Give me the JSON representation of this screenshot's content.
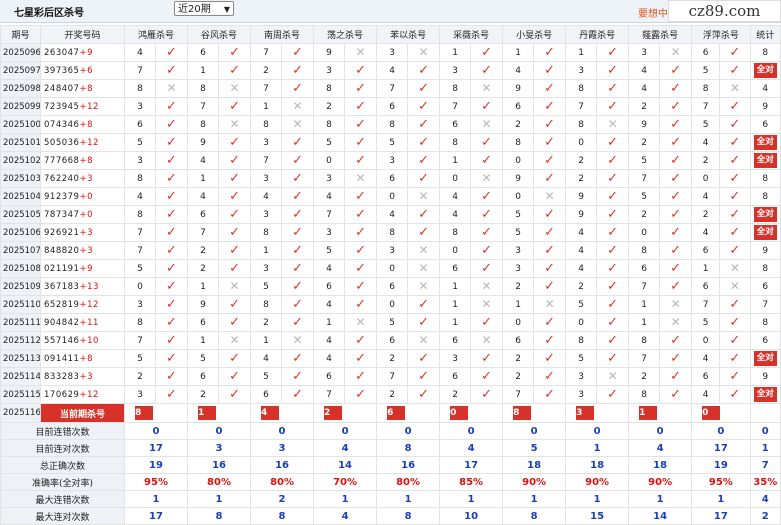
{
  "header": {
    "title": "七星彩后区杀号",
    "select_value": "近20期",
    "promo": "要想中大",
    "logo": "cz89.com"
  },
  "columns": {
    "period": "期号",
    "draw": "开奖号码",
    "experts": [
      "鸿雁杀号",
      "谷风杀号",
      "南周杀号",
      "荡之杀号",
      "苯以杀号",
      "采薇杀号",
      "小旻杀号",
      "丹霞杀号",
      "薤露杀号",
      "浮萍杀号"
    ],
    "total": "统计"
  },
  "rows": [
    {
      "period": "2025096",
      "draw": "263047",
      "sum": "+9",
      "picks": [
        [
          4,
          1
        ],
        [
          6,
          1
        ],
        [
          7,
          1
        ],
        [
          9,
          0
        ],
        [
          3,
          0
        ],
        [
          1,
          1
        ],
        [
          1,
          1
        ],
        [
          1,
          1
        ],
        [
          3,
          0
        ],
        [
          6,
          1
        ]
      ],
      "total": "8"
    },
    {
      "period": "2025097",
      "draw": "397365",
      "sum": "+6",
      "picks": [
        [
          7,
          1
        ],
        [
          1,
          1
        ],
        [
          2,
          1
        ],
        [
          3,
          1
        ],
        [
          4,
          1
        ],
        [
          3,
          1
        ],
        [
          4,
          1
        ],
        [
          3,
          1
        ],
        [
          4,
          1
        ],
        [
          5,
          1
        ]
      ],
      "total": "全对"
    },
    {
      "period": "2025098",
      "draw": "248407",
      "sum": "+8",
      "picks": [
        [
          8,
          0
        ],
        [
          8,
          0
        ],
        [
          7,
          1
        ],
        [
          8,
          1
        ],
        [
          7,
          1
        ],
        [
          8,
          0
        ],
        [
          9,
          1
        ],
        [
          8,
          1
        ],
        [
          4,
          1
        ],
        [
          8,
          0
        ]
      ],
      "total": "4"
    },
    {
      "period": "2025099",
      "draw": "723945",
      "sum": "+12",
      "picks": [
        [
          3,
          1
        ],
        [
          7,
          1
        ],
        [
          1,
          0
        ],
        [
          2,
          1
        ],
        [
          6,
          1
        ],
        [
          7,
          1
        ],
        [
          6,
          1
        ],
        [
          7,
          1
        ],
        [
          2,
          1
        ],
        [
          7,
          1
        ]
      ],
      "total": "9"
    },
    {
      "period": "2025100",
      "draw": "074346",
      "sum": "+8",
      "picks": [
        [
          6,
          1
        ],
        [
          8,
          0
        ],
        [
          8,
          0
        ],
        [
          8,
          1
        ],
        [
          8,
          1
        ],
        [
          6,
          0
        ],
        [
          2,
          1
        ],
        [
          8,
          0
        ],
        [
          9,
          1
        ],
        [
          5,
          1
        ]
      ],
      "total": "6"
    },
    {
      "period": "2025101",
      "draw": "505036",
      "sum": "+12",
      "picks": [
        [
          5,
          1
        ],
        [
          9,
          1
        ],
        [
          3,
          1
        ],
        [
          5,
          1
        ],
        [
          5,
          1
        ],
        [
          8,
          1
        ],
        [
          8,
          1
        ],
        [
          0,
          1
        ],
        [
          2,
          1
        ],
        [
          4,
          1
        ]
      ],
      "total": "全对"
    },
    {
      "period": "2025102",
      "draw": "777668",
      "sum": "+8",
      "picks": [
        [
          3,
          1
        ],
        [
          4,
          1
        ],
        [
          7,
          1
        ],
        [
          0,
          1
        ],
        [
          3,
          1
        ],
        [
          1,
          1
        ],
        [
          0,
          1
        ],
        [
          2,
          1
        ],
        [
          5,
          1
        ],
        [
          2,
          1
        ]
      ],
      "total": "全对"
    },
    {
      "period": "2025103",
      "draw": "762240",
      "sum": "+3",
      "picks": [
        [
          8,
          1
        ],
        [
          1,
          1
        ],
        [
          3,
          1
        ],
        [
          3,
          0
        ],
        [
          6,
          1
        ],
        [
          0,
          0
        ],
        [
          9,
          1
        ],
        [
          2,
          1
        ],
        [
          7,
          1
        ],
        [
          0,
          1
        ]
      ],
      "total": "8"
    },
    {
      "period": "2025104",
      "draw": "912379",
      "sum": "+0",
      "picks": [
        [
          4,
          1
        ],
        [
          4,
          1
        ],
        [
          4,
          1
        ],
        [
          4,
          1
        ],
        [
          0,
          0
        ],
        [
          4,
          1
        ],
        [
          0,
          0
        ],
        [
          9,
          1
        ],
        [
          5,
          1
        ],
        [
          4,
          1
        ]
      ],
      "total": "8"
    },
    {
      "period": "2025105",
      "draw": "787347",
      "sum": "+0",
      "picks": [
        [
          8,
          1
        ],
        [
          6,
          1
        ],
        [
          3,
          1
        ],
        [
          7,
          1
        ],
        [
          4,
          1
        ],
        [
          4,
          1
        ],
        [
          5,
          1
        ],
        [
          9,
          1
        ],
        [
          2,
          1
        ],
        [
          2,
          1
        ]
      ],
      "total": "全对"
    },
    {
      "period": "2025106",
      "draw": "926921",
      "sum": "+3",
      "picks": [
        [
          7,
          1
        ],
        [
          7,
          1
        ],
        [
          8,
          1
        ],
        [
          3,
          1
        ],
        [
          8,
          1
        ],
        [
          8,
          1
        ],
        [
          5,
          1
        ],
        [
          4,
          1
        ],
        [
          0,
          1
        ],
        [
          4,
          1
        ]
      ],
      "total": "全对"
    },
    {
      "period": "2025107",
      "draw": "848820",
      "sum": "+3",
      "picks": [
        [
          7,
          1
        ],
        [
          2,
          1
        ],
        [
          1,
          1
        ],
        [
          5,
          1
        ],
        [
          3,
          0
        ],
        [
          0,
          1
        ],
        [
          3,
          1
        ],
        [
          4,
          1
        ],
        [
          8,
          1
        ],
        [
          6,
          1
        ]
      ],
      "total": "9"
    },
    {
      "period": "2025108",
      "draw": "021191",
      "sum": "+9",
      "picks": [
        [
          5,
          1
        ],
        [
          2,
          1
        ],
        [
          3,
          1
        ],
        [
          4,
          1
        ],
        [
          0,
          0
        ],
        [
          6,
          1
        ],
        [
          3,
          1
        ],
        [
          4,
          1
        ],
        [
          6,
          1
        ],
        [
          1,
          0
        ]
      ],
      "total": "8"
    },
    {
      "period": "2025109",
      "draw": "367183",
      "sum": "+13",
      "picks": [
        [
          0,
          1
        ],
        [
          1,
          0
        ],
        [
          5,
          1
        ],
        [
          6,
          1
        ],
        [
          6,
          0
        ],
        [
          1,
          0
        ],
        [
          2,
          1
        ],
        [
          2,
          1
        ],
        [
          7,
          1
        ],
        [
          6,
          0
        ]
      ],
      "total": "6"
    },
    {
      "period": "2025110",
      "draw": "652819",
      "sum": "+12",
      "picks": [
        [
          3,
          1
        ],
        [
          9,
          1
        ],
        [
          8,
          1
        ],
        [
          4,
          1
        ],
        [
          0,
          1
        ],
        [
          1,
          0
        ],
        [
          1,
          0
        ],
        [
          5,
          1
        ],
        [
          1,
          0
        ],
        [
          7,
          1
        ]
      ],
      "total": "7"
    },
    {
      "period": "2025111",
      "draw": "904842",
      "sum": "+11",
      "picks": [
        [
          8,
          1
        ],
        [
          6,
          1
        ],
        [
          2,
          1
        ],
        [
          1,
          0
        ],
        [
          5,
          1
        ],
        [
          1,
          1
        ],
        [
          0,
          1
        ],
        [
          0,
          1
        ],
        [
          1,
          0
        ],
        [
          5,
          1
        ]
      ],
      "total": "8"
    },
    {
      "period": "2025112",
      "draw": "557146",
      "sum": "+10",
      "picks": [
        [
          7,
          1
        ],
        [
          1,
          0
        ],
        [
          1,
          0
        ],
        [
          4,
          1
        ],
        [
          6,
          0
        ],
        [
          6,
          0
        ],
        [
          6,
          1
        ],
        [
          8,
          1
        ],
        [
          8,
          1
        ],
        [
          0,
          1
        ]
      ],
      "total": "6"
    },
    {
      "period": "2025113",
      "draw": "091411",
      "sum": "+8",
      "picks": [
        [
          5,
          1
        ],
        [
          5,
          1
        ],
        [
          4,
          1
        ],
        [
          4,
          1
        ],
        [
          2,
          1
        ],
        [
          3,
          1
        ],
        [
          2,
          1
        ],
        [
          5,
          1
        ],
        [
          7,
          1
        ],
        [
          4,
          1
        ]
      ],
      "total": "全对"
    },
    {
      "period": "2025114",
      "draw": "833283",
      "sum": "+3",
      "picks": [
        [
          2,
          1
        ],
        [
          6,
          1
        ],
        [
          5,
          1
        ],
        [
          6,
          1
        ],
        [
          7,
          1
        ],
        [
          6,
          1
        ],
        [
          2,
          1
        ],
        [
          3,
          0
        ],
        [
          2,
          1
        ],
        [
          6,
          1
        ]
      ],
      "total": "9"
    },
    {
      "period": "2025115",
      "draw": "170629",
      "sum": "+12",
      "picks": [
        [
          3,
          1
        ],
        [
          2,
          1
        ],
        [
          6,
          1
        ],
        [
          7,
          1
        ],
        [
          2,
          1
        ],
        [
          2,
          1
        ],
        [
          7,
          1
        ],
        [
          3,
          1
        ],
        [
          8,
          1
        ],
        [
          4,
          1
        ]
      ],
      "total": "全对"
    }
  ],
  "current": {
    "period": "2025116",
    "label": "当前期杀号",
    "values": [
      "8",
      "1",
      "4",
      "2",
      "6",
      "0",
      "8",
      "3",
      "1",
      "0"
    ]
  },
  "stats": [
    {
      "label": "目前连错次数",
      "values": [
        "0",
        "0",
        "0",
        "0",
        "0",
        "0",
        "0",
        "0",
        "0",
        "0",
        "0"
      ],
      "cls": "blue"
    },
    {
      "label": "目前连对次数",
      "values": [
        "17",
        "3",
        "3",
        "4",
        "8",
        "4",
        "5",
        "1",
        "4",
        "17",
        "1"
      ],
      "cls": "blue"
    },
    {
      "label": "总正确次数",
      "values": [
        "19",
        "16",
        "16",
        "14",
        "16",
        "17",
        "18",
        "18",
        "18",
        "19",
        "7"
      ],
      "cls": "blue"
    },
    {
      "label": "准确率(全对率)",
      "values": [
        "95%",
        "80%",
        "80%",
        "70%",
        "80%",
        "85%",
        "90%",
        "90%",
        "90%",
        "95%",
        "35%"
      ],
      "cls": "red"
    },
    {
      "label": "最大连错次数",
      "values": [
        "1",
        "1",
        "2",
        "1",
        "1",
        "1",
        "1",
        "1",
        "1",
        "1",
        "4"
      ],
      "cls": "blue"
    },
    {
      "label": "最大连对次数",
      "values": [
        "17",
        "8",
        "8",
        "4",
        "8",
        "10",
        "8",
        "15",
        "14",
        "17",
        "2"
      ],
      "cls": "blue"
    }
  ],
  "colors": {
    "accent": "#d6322a",
    "check": "#e0332b",
    "cross": "#b8b8b8",
    "stat_blue": "#1a3fb8"
  },
  "icons": {
    "correct": "check-icon",
    "wrong": "cross-icon"
  }
}
